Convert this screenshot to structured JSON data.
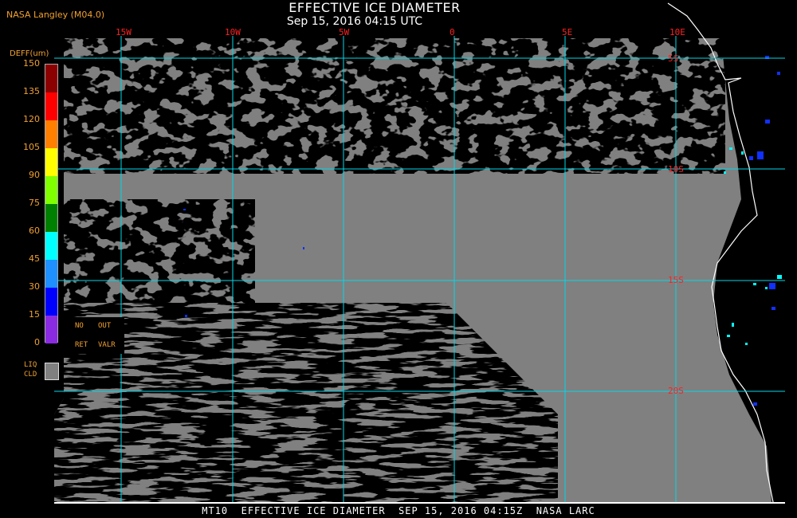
{
  "header": {
    "agency": "NASA Langley (M04.0)",
    "title": "EFFECTIVE ICE DIAMETER",
    "subtitle": "Sep 15, 2016 04:15 UTC"
  },
  "longitude_labels": [
    "15W",
    "10W",
    "5W",
    "0",
    "5E",
    "10E"
  ],
  "latitude_labels": [
    "5S",
    "10S",
    "15S",
    "20S"
  ],
  "legend": {
    "unit": "DEFF(um)",
    "ticks": [
      "150",
      "135",
      "120",
      "105",
      "90",
      "75",
      "60",
      "45",
      "30",
      "15",
      "0"
    ],
    "colors": [
      "#8b0000",
      "#ff0000",
      "#ff7f00",
      "#ffff00",
      "#7fff00",
      "#008000",
      "#00ffff",
      "#1e90ff",
      "#0000ff",
      "#8a2be2"
    ],
    "no_retrieval": {
      "line1_a": "NO",
      "line1_b": "OUT",
      "line2_a": "RET",
      "line2_b": "VALR"
    },
    "liquid_cloud": {
      "line1": "LIQ",
      "line2": "CLD",
      "color": "#808080"
    }
  },
  "map_colors": {
    "cloud_gray": "#808080",
    "clear": "#000000",
    "grid": "#00d8e8",
    "coast": "#ffffff",
    "grid_label": "#ff2020"
  },
  "footer": "MT10  EFFECTIVE ICE DIAMETER  SEP 15, 2016 04:15Z  NASA LARC"
}
